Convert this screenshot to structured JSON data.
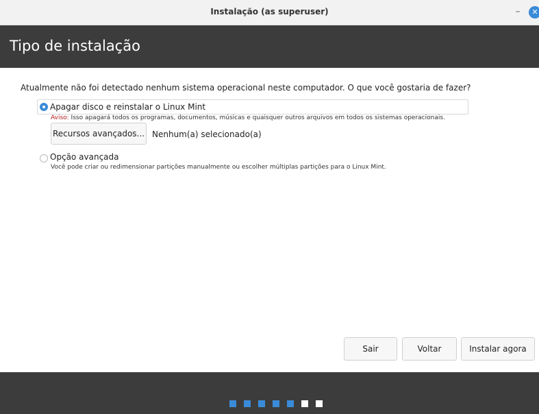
{
  "window": {
    "title": "Instalação (as superuser)",
    "minimize_glyph": "–",
    "close_glyph": "✕"
  },
  "header": {
    "title": "Tipo de instalação"
  },
  "content": {
    "question": "Atualmente não foi detectado nenhum sistema operacional neste computador. O que você gostaria de fazer?",
    "option_erase": {
      "label": "Apagar disco e reinstalar o Linux Mint",
      "selected": true,
      "warning_prefix": "Aviso:",
      "warning_text": " Isso apagará todos os programas, documentos, músicas e quaisquer outros arquivos em todos os sistemas operacionais.",
      "advanced_button": "Recursos avançados...",
      "advanced_status": "Nenhum(a) selecionado(a)"
    },
    "option_advanced": {
      "label": "Opção avançada",
      "selected": false,
      "description": "Você pode criar ou redimensionar partições manualmente ou escolher múltiplas partições para o Linux Mint."
    }
  },
  "buttons": {
    "quit": "Sair",
    "back": "Voltar",
    "install": "Instalar agora"
  },
  "progress": {
    "total_steps": 7,
    "completed_steps": 5
  },
  "colors": {
    "accent": "#3a8bd8",
    "header_bg": "#3c3c3c",
    "warning": "#b32020"
  }
}
